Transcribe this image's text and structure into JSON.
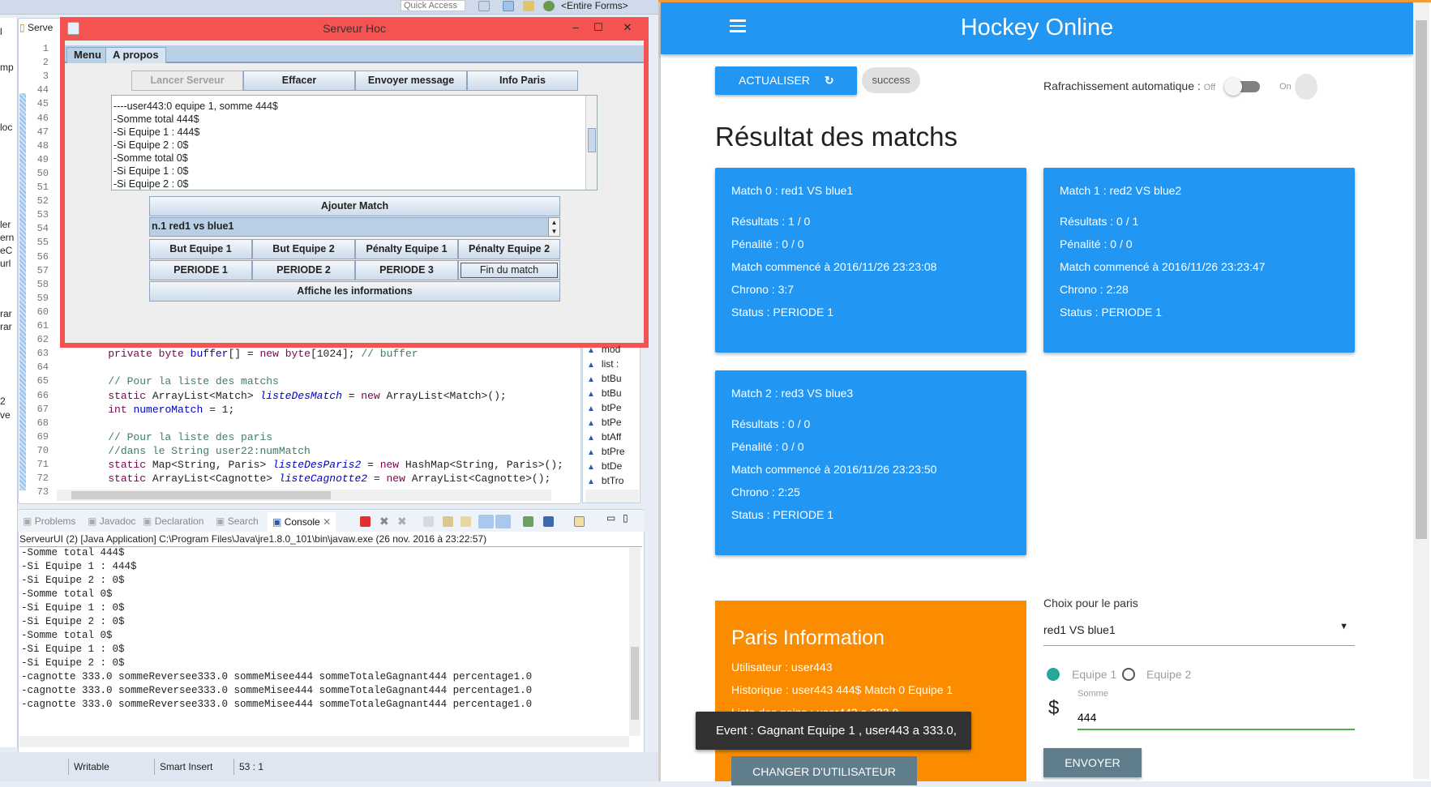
{
  "eclipse": {
    "quick_access": "Quick Access",
    "perspective": "<Entire Forms>",
    "editor_tab": "Serve",
    "package_explorer_fragments": [
      "l",
      "mp",
      "loc",
      "ler",
      "ern",
      "eC",
      "url",
      "rar",
      "rar",
      "2",
      "ve"
    ],
    "line_numbers": [
      "1",
      "2",
      "3",
      "44",
      "45",
      "46",
      "47",
      "48",
      "49",
      "50",
      "51",
      "52",
      "53",
      "54",
      "55",
      "56",
      "57",
      "58",
      "59",
      "60",
      "61",
      "62",
      "63",
      "64",
      "65",
      "66",
      "67",
      "68",
      "69",
      "70",
      "71",
      "72",
      "73"
    ],
    "code_lines": [
      {
        "line": "63",
        "tokens": [
          [
            "    ",
            "plain"
          ],
          [
            "private",
            "kw"
          ],
          [
            " ",
            "plain"
          ],
          [
            "byte",
            "kw"
          ],
          [
            " ",
            "plain"
          ],
          [
            "buffer",
            "fld"
          ],
          [
            "[] = ",
            "plain"
          ],
          [
            "new",
            "kw"
          ],
          [
            " ",
            "plain"
          ],
          [
            "byte",
            "kw"
          ],
          [
            "[1024]; ",
            "plain"
          ],
          [
            "// buffer",
            "cm"
          ]
        ]
      },
      {
        "line": "65",
        "tokens": [
          [
            "    ",
            "plain"
          ],
          [
            "// Pour la liste des matchs",
            "cm"
          ]
        ]
      },
      {
        "line": "66",
        "tokens": [
          [
            "    ",
            "plain"
          ],
          [
            "static",
            "kw"
          ],
          [
            " ArrayList<Match> ",
            "plain"
          ],
          [
            "listeDesMatch",
            "sfld"
          ],
          [
            " = ",
            "plain"
          ],
          [
            "new",
            "kw"
          ],
          [
            " ArrayList<Match>();",
            "plain"
          ]
        ]
      },
      {
        "line": "67",
        "tokens": [
          [
            "    ",
            "plain"
          ],
          [
            "int",
            "kw"
          ],
          [
            " ",
            "plain"
          ],
          [
            "numeroMatch",
            "fld"
          ],
          [
            " = 1;",
            "plain"
          ]
        ]
      },
      {
        "line": "69",
        "tokens": [
          [
            "    ",
            "plain"
          ],
          [
            "// Pour la liste des paris",
            "cm"
          ]
        ]
      },
      {
        "line": "70",
        "tokens": [
          [
            "    ",
            "plain"
          ],
          [
            "//dans le String user22:numMatch",
            "cm"
          ]
        ]
      },
      {
        "line": "71",
        "tokens": [
          [
            "    ",
            "plain"
          ],
          [
            "static",
            "kw"
          ],
          [
            " Map<String, Paris> ",
            "plain"
          ],
          [
            "listeDesParis2",
            "sfld"
          ],
          [
            " = ",
            "plain"
          ],
          [
            "new",
            "kw"
          ],
          [
            " HashMap<String, Paris>();",
            "plain"
          ]
        ]
      },
      {
        "line": "72",
        "tokens": [
          [
            "    ",
            "plain"
          ],
          [
            "static",
            "kw"
          ],
          [
            " ArrayList<Cagnotte> ",
            "plain"
          ],
          [
            "listeCagnotte2",
            "sfld"
          ],
          [
            " = ",
            "plain"
          ],
          [
            "new",
            "kw"
          ],
          [
            " ArrayList<Cagnotte>();",
            "plain"
          ]
        ]
      }
    ],
    "outline_items": [
      "mod",
      "list : ",
      "btBu",
      "btBu",
      "btPe",
      "btPe",
      "btAff",
      "btPre",
      "btDe",
      "btTro"
    ],
    "console_tabs": [
      "Problems",
      "Javadoc",
      "Declaration",
      "Search",
      "Console"
    ],
    "console_header": "ServeurUI (2) [Java Application] C:\\Program Files\\Java\\jre1.8.0_101\\bin\\javaw.exe (26 nov. 2016 à 23:22:57)",
    "console_lines": [
      "-Somme total 444$",
      "-Si Equipe 1 : 444$",
      "-Si Equipe 2 : 0$",
      "-Somme total 0$",
      "-Si Equipe 1 : 0$",
      "-Si Equipe 2 : 0$",
      "-Somme total 0$",
      "-Si Equipe 1 : 0$",
      "-Si Equipe 2 : 0$",
      "-cagnotte 333.0 sommeReversee333.0 sommeMisee444 sommeTotaleGagnant444 percentage1.0",
      "-cagnotte 333.0 sommeReversee333.0 sommeMisee444 sommeTotaleGagnant444 percentage1.0",
      "-cagnotte 333.0 sommeReversee333.0 sommeMisee444 sommeTotaleGagnant444 percentage1.0"
    ],
    "status": {
      "mode": "Writable",
      "insert": "Smart Insert",
      "position": "53 : 1"
    }
  },
  "swing": {
    "title": "Serveur Hoc",
    "tabs": [
      "Menu",
      "A propos"
    ],
    "top_buttons": [
      "Lancer Serveur",
      "Effacer",
      "Envoyer message",
      "Info Paris"
    ],
    "text_lines": [
      "----user443:0 equipe 1, somme 444$",
      "-Somme total 444$",
      "-Si Equipe 1 : 444$",
      "-Si Equipe 2 : 0$",
      "-Somme total 0$",
      "-Si Equipe 1 : 0$",
      "-Si Equipe 2 : 0$"
    ],
    "add_match": "Ajouter Match",
    "match_spinner": "n.1 red1 vs blue1",
    "goal_buttons": [
      "But Equipe 1",
      "But Equipe 2",
      "Pénalty Equipe 1",
      "Pénalty Equipe 2"
    ],
    "period_buttons": [
      "PERIODE 1",
      "PERIODE 2",
      "PERIODE 3",
      "Fin du match"
    ],
    "info_button": "Affiche les informations"
  },
  "web": {
    "title": "Hockey Online",
    "refresh_label": "ACTUALISER",
    "chip": "success",
    "auto_label": "Rafrachissement automatique :",
    "off": "Off",
    "on": "On",
    "auto_refresh_on": false,
    "results_title": "Résultat des matchs",
    "matches": [
      {
        "title": "Match 0 : red1 VS blue1",
        "result": "Résultats : 1 / 0",
        "penalty": "Pénalité : 0 / 0",
        "start": "Match commencé à 2016/11/26 23:23:08",
        "chrono": "Chrono : 3:7",
        "status": "Status : PERIODE 1"
      },
      {
        "title": "Match 1 : red2 VS blue2",
        "result": "Résultats : 0 / 1",
        "penalty": "Pénalité : 0 / 0",
        "start": "Match commencé à 2016/11/26 23:23:47",
        "chrono": "Chrono : 2:28",
        "status": "Status : PERIODE 1"
      },
      {
        "title": "Match 2 : red3 VS blue3",
        "result": "Résultats : 0 / 0",
        "penalty": "Pénalité : 0 / 0",
        "start": "Match commencé à 2016/11/26 23:23:50",
        "chrono": "Chrono : 2:25",
        "status": "Status : PERIODE 1"
      }
    ],
    "paris": {
      "title": "Paris Information",
      "user": "Utilisateur : user443",
      "history": "Historique : user443 444$ Match 0 Equipe 1",
      "gains": "Liste des gains : user443 a 333.0",
      "change_user": "CHANGER D'UTILISATEUR"
    },
    "toast": "Event : Gagnant Equipe 1 , user443 a 333.0,",
    "bet": {
      "choice_label": "Choix pour le paris",
      "choice_value": "red1 VS blue1",
      "team1": "Equipe 1",
      "team2": "Equipe 2",
      "selected_team": "Equipe 1",
      "amount_label": "Somme",
      "currency": "$",
      "amount": "444",
      "submit": "ENVOYER"
    },
    "colors": {
      "primary": "#2196f3",
      "accent": "#fb8c00",
      "button": "#607d8b",
      "radio": "#26a69a",
      "input_line": "#4caf50"
    }
  }
}
